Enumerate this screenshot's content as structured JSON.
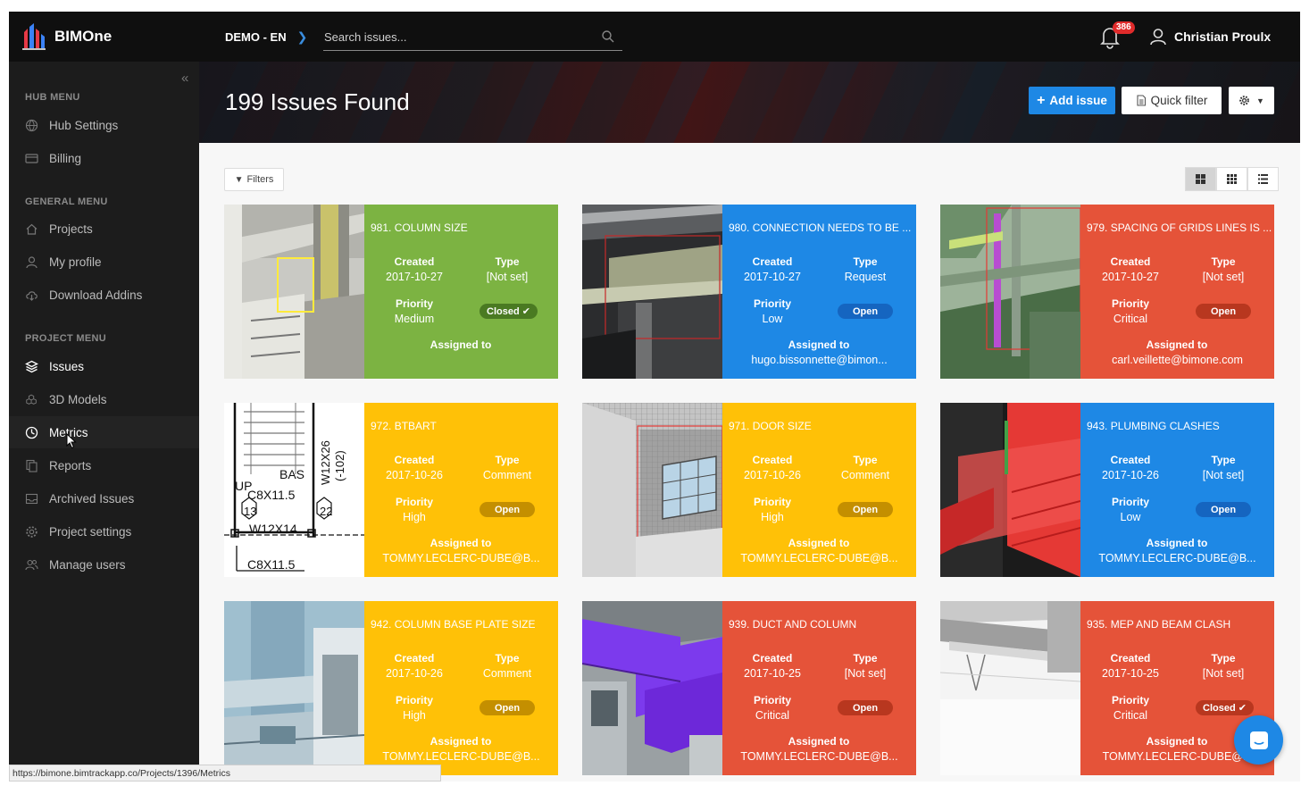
{
  "brand": {
    "name": "BIMOne"
  },
  "topbar": {
    "project": "DEMO - EN",
    "search_placeholder": "Search issues...",
    "notifications": "386",
    "user": "Christian Proulx"
  },
  "sidebar": {
    "hub_title": "HUB MENU",
    "hub_items": [
      "Hub Settings",
      "Billing"
    ],
    "general_title": "GENERAL MENU",
    "general_items": [
      "Projects",
      "My profile",
      "Download Addins"
    ],
    "project_title": "PROJECT MENU",
    "project_items": [
      "Issues",
      "3D Models",
      "Metrics",
      "Reports",
      "Archived Issues",
      "Project settings",
      "Manage users"
    ]
  },
  "header": {
    "title": "199 Issues Found",
    "add_label": "Add issue",
    "quick_label": "Quick filter"
  },
  "toolbar": {
    "filters_label": "Filters"
  },
  "labels": {
    "created": "Created",
    "type": "Type",
    "priority": "Priority",
    "assigned": "Assigned to"
  },
  "issues": [
    {
      "title": "981. COLUMN SIZE",
      "created": "2017-10-27",
      "type": "[Not set]",
      "priority": "Medium",
      "status": "Closed",
      "assigned": "",
      "color": "#7cb342"
    },
    {
      "title": "980. CONNECTION NEEDS TO BE ...",
      "created": "2017-10-27",
      "type": "Request",
      "priority": "Low",
      "status": "Open",
      "assigned": "hugo.bissonnette@bimon...",
      "color": "#1e88e5"
    },
    {
      "title": "979. SPACING OF GRIDS LINES IS ...",
      "created": "2017-10-27",
      "type": "[Not set]",
      "priority": "Critical",
      "status": "Open",
      "assigned": "carl.veillette@bimone.com",
      "color": "#e55339"
    },
    {
      "title": "972. BTBART",
      "created": "2017-10-26",
      "type": "Comment",
      "priority": "High",
      "status": "Open",
      "assigned": "TOMMY.LECLERC-DUBE@B...",
      "color": "#ffc107"
    },
    {
      "title": "971. DOOR SIZE",
      "created": "2017-10-26",
      "type": "Comment",
      "priority": "High",
      "status": "Open",
      "assigned": "TOMMY.LECLERC-DUBE@B...",
      "color": "#ffc107"
    },
    {
      "title": "943. PLUMBING CLASHES",
      "created": "2017-10-26",
      "type": "[Not set]",
      "priority": "Low",
      "status": "Open",
      "assigned": "TOMMY.LECLERC-DUBE@B...",
      "color": "#1e88e5"
    },
    {
      "title": "942. COLUMN BASE PLATE SIZE",
      "created": "2017-10-26",
      "type": "Comment",
      "priority": "High",
      "status": "Open",
      "assigned": "TOMMY.LECLERC-DUBE@B...",
      "color": "#ffc107"
    },
    {
      "title": "939. DUCT AND COLUMN",
      "created": "2017-10-25",
      "type": "[Not set]",
      "priority": "Critical",
      "status": "Open",
      "assigned": "TOMMY.LECLERC-DUBE@B...",
      "color": "#e55339"
    },
    {
      "title": "935. MEP AND BEAM CLASH",
      "created": "2017-10-25",
      "type": "[Not set]",
      "priority": "Critical",
      "status": "Closed",
      "assigned": "TOMMY.LECLERC-DUBE@...",
      "color": "#e55339"
    }
  ],
  "drawing": {
    "labels": [
      "BAS",
      "UP",
      "C8X11.5",
      "13",
      "22",
      "W12X14",
      "C8X11.5",
      "W12X26",
      "(-102)"
    ]
  },
  "statusbar": {
    "url": "https://bimone.bimtrackapp.co/Projects/1396/Metrics"
  }
}
